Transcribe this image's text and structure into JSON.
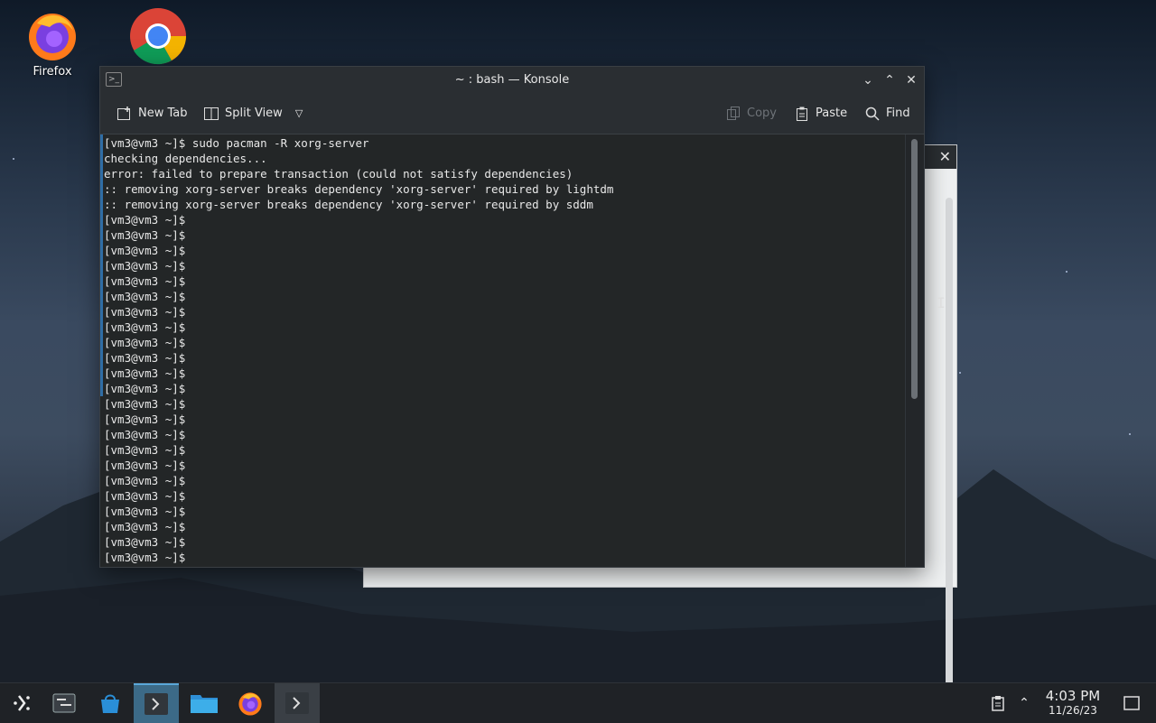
{
  "desktop": {
    "icons": [
      {
        "label": "Firefox",
        "icon": "firefox-icon"
      },
      {
        "label": "",
        "icon": "chrome-icon"
      }
    ]
  },
  "konsole": {
    "title": "~ : bash — Konsole",
    "toolbar": {
      "new_tab": "New Tab",
      "split_view": "Split View",
      "copy": "Copy",
      "paste": "Paste",
      "find": "Find"
    },
    "lines": [
      "[vm3@vm3 ~]$ sudo pacman -R xorg-server",
      "checking dependencies...",
      "error: failed to prepare transaction (could not satisfy dependencies)",
      ":: removing xorg-server breaks dependency 'xorg-server' required by lightdm",
      ":: removing xorg-server breaks dependency 'xorg-server' required by sddm",
      "[vm3@vm3 ~]$",
      "[vm3@vm3 ~]$",
      "[vm3@vm3 ~]$",
      "[vm3@vm3 ~]$",
      "[vm3@vm3 ~]$",
      "[vm3@vm3 ~]$",
      "[vm3@vm3 ~]$",
      "[vm3@vm3 ~]$",
      "[vm3@vm3 ~]$",
      "[vm3@vm3 ~]$",
      "[vm3@vm3 ~]$",
      "[vm3@vm3 ~]$",
      "[vm3@vm3 ~]$",
      "[vm3@vm3 ~]$",
      "[vm3@vm3 ~]$",
      "[vm3@vm3 ~]$",
      "[vm3@vm3 ~]$",
      "[vm3@vm3 ~]$",
      "[vm3@vm3 ~]$",
      "[vm3@vm3 ~]$",
      "[vm3@vm3 ~]$",
      "[vm3@vm3 ~]$",
      "[vm3@vm3 ~]$"
    ]
  },
  "taskbar": {
    "time": "4:03 PM",
    "date": "11/26/23",
    "items": [
      "application-launcher-icon",
      "overview-icon",
      "discover-store-icon",
      "konsole-icon",
      "file-manager-icon",
      "firefox-icon",
      "konsole-icon"
    ]
  },
  "colors": {
    "accent": "#3c6a87",
    "terminal_bg": "#232627",
    "titlebar": "#2a2e32"
  }
}
